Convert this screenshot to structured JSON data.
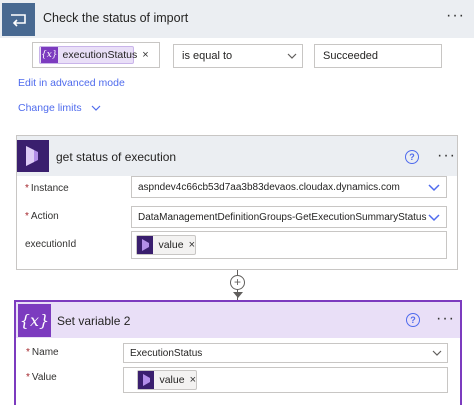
{
  "until": {
    "title": "Check the status of import",
    "condition": {
      "left_token": "executionStatus",
      "operator": "is equal to",
      "right_value": "Succeeded"
    },
    "advanced_link": "Edit in advanced mode",
    "limits_link": "Change limits"
  },
  "card1": {
    "title": "get status of execution",
    "fields": {
      "instance_label": "Instance",
      "instance_value": "aspndev4c66cb53d7aa3b83devaos.cloudax.dynamics.com",
      "action_label": "Action",
      "action_value": "DataManagementDefinitionGroups-GetExecutionSummaryStatus",
      "exec_label": "executionId",
      "exec_token": "value"
    }
  },
  "card2": {
    "title": "Set variable 2",
    "icon_glyph": "{x}",
    "fields": {
      "name_label": "Name",
      "name_value": "ExecutionStatus",
      "value_label": "Value",
      "value_token": "value"
    }
  },
  "glyphs": {
    "fx": "{x}",
    "close": "×",
    "plus": "+",
    "required": "*",
    "help": "?",
    "more": "···"
  },
  "colors": {
    "accent_purple": "#7c3bbf",
    "until_header_bg": "#ebeef2",
    "until_icon_bg": "#486991",
    "link_blue": "#4f6bed",
    "app_icon_bg": "#3a1f6e"
  }
}
